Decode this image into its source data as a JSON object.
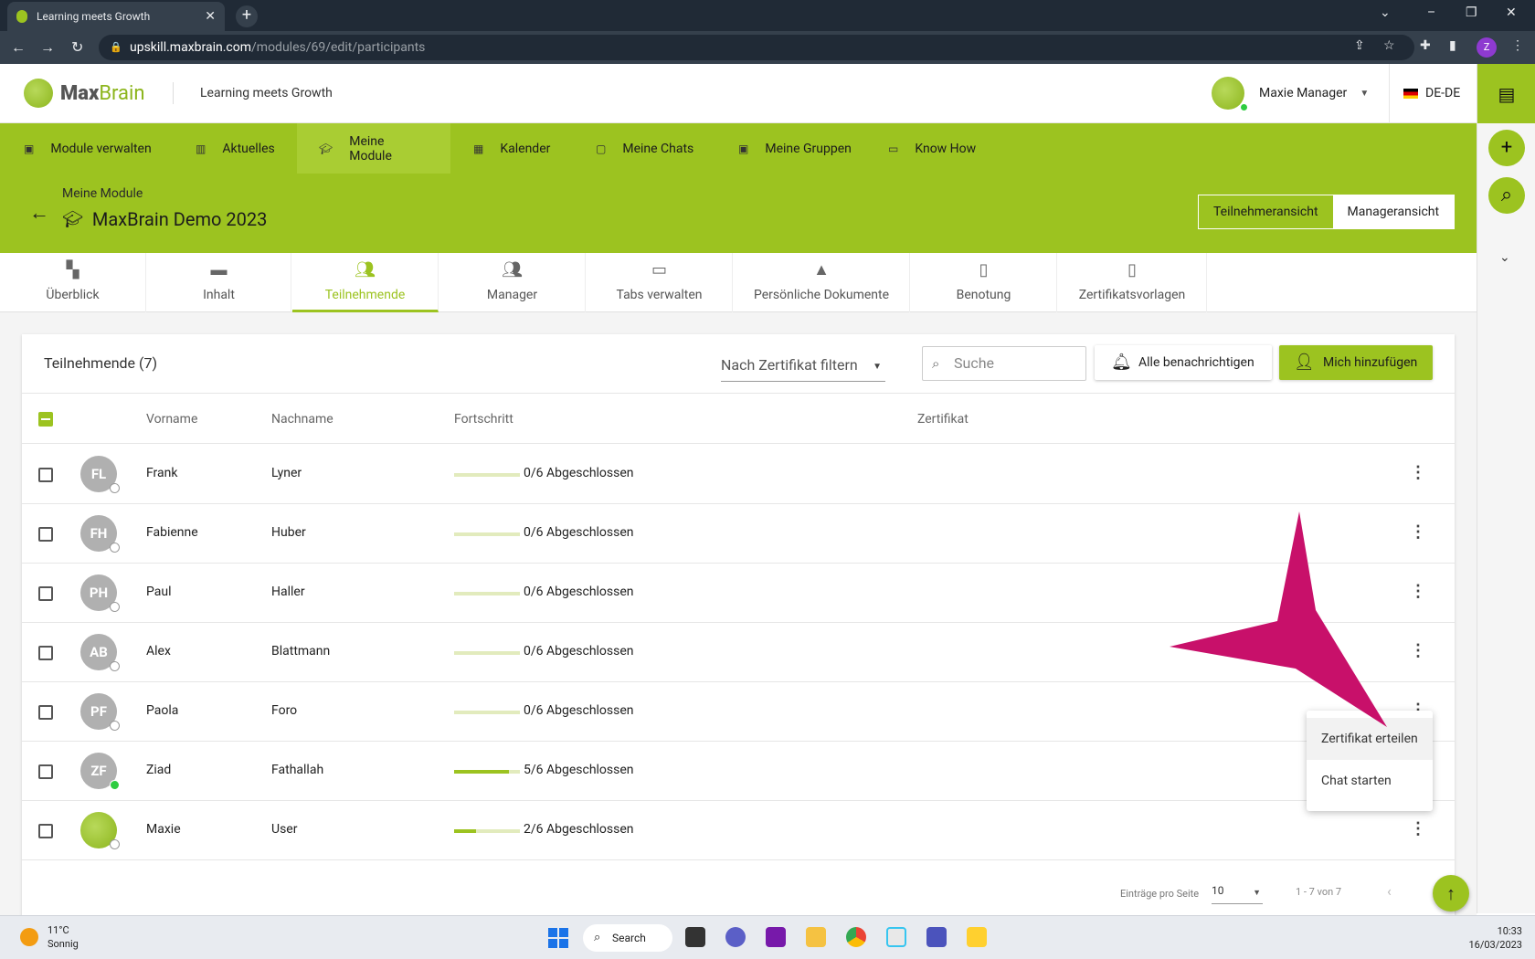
{
  "browser": {
    "tab_title": "Learning meets Growth",
    "url_host": "upskill.maxbrain.com",
    "url_path": "/modules/69/edit/participants",
    "profile_initial": "Z"
  },
  "header": {
    "logo_max": "Max",
    "logo_brain": "Brain",
    "tagline": "Learning meets Growth",
    "user_name": "Maxie Manager",
    "language": "DE-DE"
  },
  "nav": {
    "items": [
      {
        "label": "Module verwalten",
        "icon": "folder-icon"
      },
      {
        "label": "Aktuelles",
        "icon": "news-icon"
      },
      {
        "label": "Meine Module",
        "icon": "graduation-cap-icon"
      },
      {
        "label": "Kalender",
        "icon": "calendar-icon"
      },
      {
        "label": "Meine Chats",
        "icon": "chat-icon"
      },
      {
        "label": "Meine Gruppen",
        "icon": "group-icon"
      },
      {
        "label": "Know How",
        "icon": "book-icon"
      }
    ],
    "active_index": 2
  },
  "module": {
    "breadcrumb": "Meine Module",
    "title": "MaxBrain Demo 2023",
    "view_participant": "Teilnehmeransicht",
    "view_manager": "Manageransicht"
  },
  "tabs": [
    {
      "label": "Überblick",
      "icon": "dashboard-icon"
    },
    {
      "label": "Inhalt",
      "icon": "folder-icon"
    },
    {
      "label": "Teilnehmende",
      "icon": "people-icon"
    },
    {
      "label": "Manager",
      "icon": "manager-icon"
    },
    {
      "label": "Tabs verwalten",
      "icon": "window-icon"
    },
    {
      "label": "Persönliche Dokumente",
      "icon": "personal-docs-icon"
    },
    {
      "label": "Benotung",
      "icon": "grade-icon"
    },
    {
      "label": "Zertifikatsvorlagen",
      "icon": "certificate-settings-icon"
    }
  ],
  "participants": {
    "title": "Teilnehmende (7)",
    "filter_placeholder": "Nach Zertifikat filtern",
    "search_placeholder": "Suche",
    "notify_label": "Alle benachrichtigen",
    "add_me_label": "Mich hinzufügen",
    "columns": {
      "first_name": "Vorname",
      "last_name": "Nachname",
      "progress": "Fortschritt",
      "certificate": "Zertifikat"
    },
    "rows": [
      {
        "initials": "FL",
        "first": "Frank",
        "last": "Lyner",
        "progress_text": "0/6 Abgeschlossen",
        "progress": 0,
        "online": false
      },
      {
        "initials": "FH",
        "first": "Fabienne",
        "last": "Huber",
        "progress_text": "0/6 Abgeschlossen",
        "progress": 0,
        "online": false
      },
      {
        "initials": "PH",
        "first": "Paul",
        "last": "Haller",
        "progress_text": "0/6 Abgeschlossen",
        "progress": 0,
        "online": false
      },
      {
        "initials": "AB",
        "first": "Alex",
        "last": "Blattmann",
        "progress_text": "0/6 Abgeschlossen",
        "progress": 0,
        "online": false
      },
      {
        "initials": "PF",
        "first": "Paola",
        "last": "Foro",
        "progress_text": "0/6 Abgeschlossen",
        "progress": 0,
        "online": false
      },
      {
        "initials": "ZF",
        "first": "Ziad",
        "last": "Fathallah",
        "progress_text": "5/6 Abgeschlossen",
        "progress": 0.833,
        "online": true
      },
      {
        "initials": "",
        "first": "Maxie",
        "last": "User",
        "progress_text": "2/6 Abgeschlossen",
        "progress": 0.333,
        "online": false
      }
    ],
    "context_menu": [
      "Zertifikat erteilen",
      "Chat starten"
    ],
    "pager_label": "Einträge pro Seite",
    "pager_size": "10",
    "pager_range": "1 - 7 von 7"
  },
  "taskbar": {
    "temperature": "11°C",
    "weather": "Sonnig",
    "search": "Search",
    "time": "10:33",
    "date": "16/03/2023"
  },
  "colors": {
    "accent": "#9cc320",
    "pointer": "#c8106a"
  }
}
